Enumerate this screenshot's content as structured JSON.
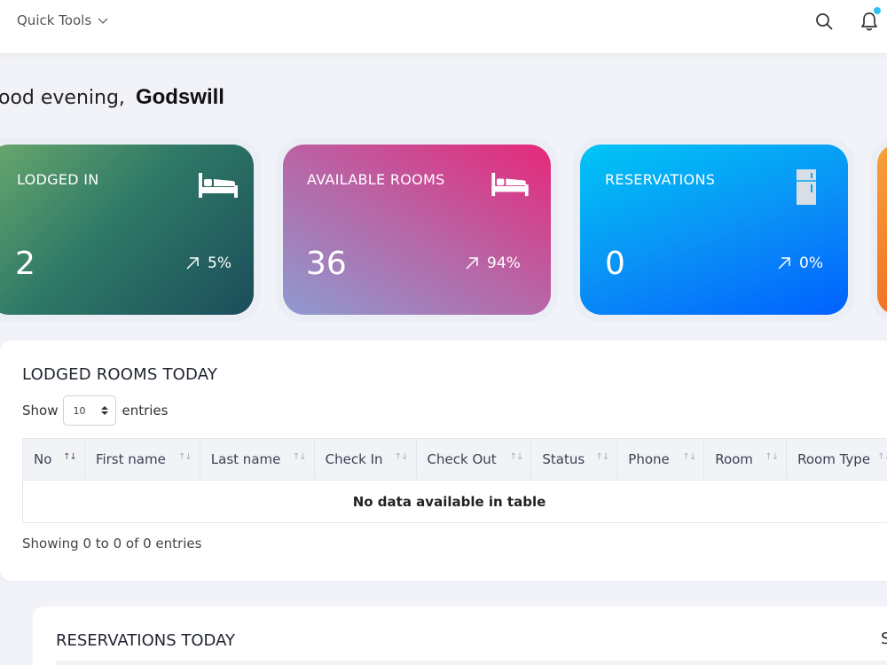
{
  "topbar": {
    "quick_tools_label": "Quick Tools"
  },
  "greeting": {
    "lead": "ood evening,",
    "user": "Godswill"
  },
  "cards": [
    {
      "title": "LODGED IN",
      "value": "2",
      "trend": "5%",
      "icon": "bed-icon",
      "gradient": [
        "#6aa86d",
        "#1b4d5a"
      ]
    },
    {
      "title": "AVAILABLE ROOMS",
      "value": "36",
      "trend": "94%",
      "icon": "bed-icon",
      "gradient": [
        "#8e9bd0",
        "#e6287a"
      ]
    },
    {
      "title": "RESERVATIONS",
      "value": "0",
      "trend": "0%",
      "icon": "fridge-icon",
      "gradient": [
        "#00c6f5",
        "#0061ff"
      ]
    }
  ],
  "lodged_table": {
    "title": "LODGED ROOMS TODAY",
    "show_label": "Show",
    "entries_value": "10",
    "entries_label": "entries",
    "columns": [
      "No",
      "First name",
      "Last name",
      "Check In",
      "Check Out",
      "Status",
      "Phone",
      "Room",
      "Room Type"
    ],
    "empty_message": "No data available in table",
    "footer": "Showing 0 to 0 of 0 entries"
  },
  "reservations_table": {
    "title": "RESERVATIONS TODAY",
    "cut_text": "S"
  },
  "colors": {
    "notification_dot": "#2cc2f3",
    "page_bg": "#f2f3f8"
  }
}
